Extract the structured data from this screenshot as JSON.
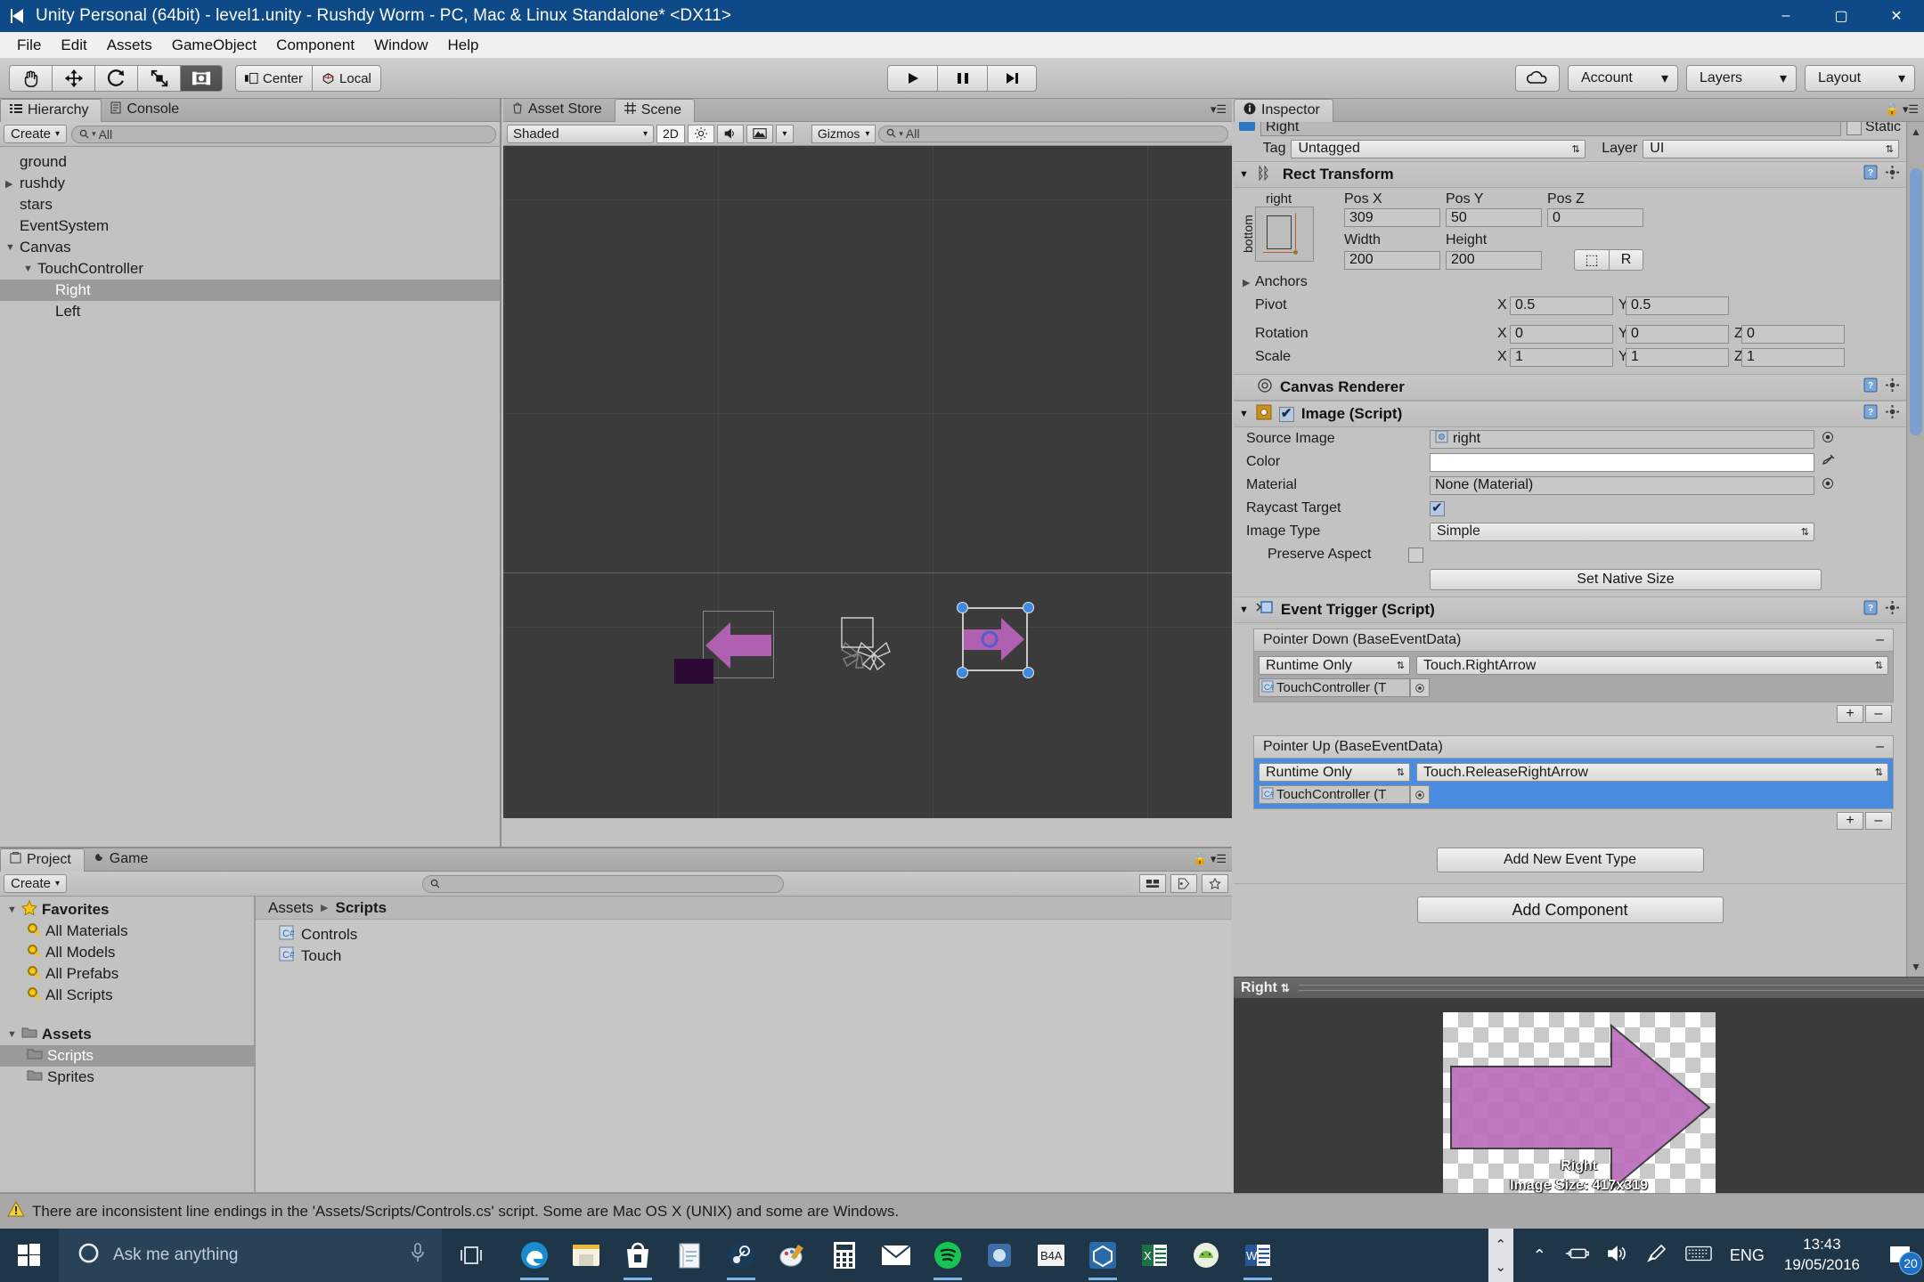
{
  "window": {
    "title": "Unity Personal (64bit) - level1.unity - Rushdy Worm - PC, Mac & Linux Standalone* <DX11>",
    "minimize": "–",
    "maximize": "▢",
    "close": "✕"
  },
  "menubar": [
    "File",
    "Edit",
    "Assets",
    "GameObject",
    "Component",
    "Window",
    "Help"
  ],
  "toolbar": {
    "transform_tools": [
      "hand-tool",
      "move-tool",
      "rotate-tool",
      "scale-tool",
      "rect-tool"
    ],
    "pivot_mode": "Center",
    "pivot_rotation": "Local",
    "play": "▶",
    "pause": "❚❚",
    "step": "▶❙",
    "cloud": "cloud-icon",
    "account": "Account",
    "layers": "Layers",
    "layout": "Layout"
  },
  "hierarchy": {
    "tabs": [
      {
        "label": "Hierarchy",
        "icon": "hierarchy-icon",
        "active": true
      },
      {
        "label": "Console",
        "icon": "console-icon",
        "active": false
      }
    ],
    "create_label": "Create",
    "search_placeholder": "All",
    "items": [
      {
        "label": "ground",
        "depth": 0,
        "arrow": "",
        "selected": false
      },
      {
        "label": "rushdy",
        "depth": 0,
        "arrow": "▶",
        "selected": false
      },
      {
        "label": "stars",
        "depth": 0,
        "arrow": "",
        "selected": false
      },
      {
        "label": "EventSystem",
        "depth": 0,
        "arrow": "",
        "selected": false
      },
      {
        "label": "Canvas",
        "depth": 0,
        "arrow": "▼",
        "selected": false
      },
      {
        "label": "TouchController",
        "depth": 1,
        "arrow": "▼",
        "selected": false
      },
      {
        "label": "Right",
        "depth": 2,
        "arrow": "",
        "selected": true
      },
      {
        "label": "Left",
        "depth": 2,
        "arrow": "",
        "selected": false
      }
    ]
  },
  "scene": {
    "tabs": [
      {
        "label": "Asset Store",
        "icon": "asset-store-icon",
        "active": false
      },
      {
        "label": "Scene",
        "icon": "scene-grid-icon",
        "active": true
      }
    ],
    "draw_mode": "Shaded",
    "toggle_2d": "2D",
    "lighting_icon": "sun-icon",
    "audio_icon": "speaker-icon",
    "effects_icon": "image-effects-icon",
    "gizmos": "Gizmos",
    "search_placeholder": "All"
  },
  "project": {
    "tabs": [
      {
        "label": "Project",
        "icon": "project-icon",
        "active": true
      },
      {
        "label": "Game",
        "icon": "game-icon",
        "active": false
      }
    ],
    "create_label": "Create",
    "search_placeholder": "",
    "favorites_label": "Favorites",
    "favorites": [
      "All Materials",
      "All Models",
      "All Prefabs",
      "All Scripts"
    ],
    "assets_label": "Assets",
    "folders": [
      {
        "label": "Scripts",
        "selected": true
      },
      {
        "label": "Sprites",
        "selected": false
      }
    ],
    "breadcrumb": [
      "Assets",
      "Scripts"
    ],
    "files": [
      {
        "label": "Controls",
        "icon": "csharp-script-icon"
      },
      {
        "label": "Touch",
        "icon": "csharp-script-icon"
      }
    ]
  },
  "inspector": {
    "tab_label": "Inspector",
    "object_name": "Right",
    "static_label": "Static",
    "tag_label": "Tag",
    "tag_value": "Untagged",
    "layer_label": "Layer",
    "layer_value": "UI",
    "rect_transform": {
      "title": "Rect Transform",
      "anchor_preset_top": "right",
      "anchor_preset_side": "bottom",
      "pos_x_label": "Pos X",
      "pos_x": "309",
      "pos_y_label": "Pos Y",
      "pos_y": "50",
      "pos_z_label": "Pos Z",
      "pos_z": "0",
      "width_label": "Width",
      "width": "200",
      "height_label": "Height",
      "height": "200",
      "blueprint_btn": "⬚",
      "raw_btn": "R",
      "anchors_label": "Anchors",
      "pivot_label": "Pivot",
      "pivot_x": "0.5",
      "pivot_y": "0.5",
      "rotation_label": "Rotation",
      "rotation_x": "0",
      "rotation_y": "0",
      "rotation_z": "0",
      "scale_label": "Scale",
      "scale_x": "1",
      "scale_y": "1",
      "scale_z": "1",
      "axis_x": "X",
      "axis_y": "Y",
      "axis_z": "Z"
    },
    "canvas_renderer": {
      "title": "Canvas Renderer"
    },
    "image_script": {
      "title": "Image (Script)",
      "enabled": true,
      "source_image_label": "Source Image",
      "source_image_value": "right",
      "color_label": "Color",
      "color_value": "#FFFFFF",
      "material_label": "Material",
      "material_value": "None (Material)",
      "raycast_label": "Raycast Target",
      "raycast_checked": true,
      "image_type_label": "Image Type",
      "image_type_value": "Simple",
      "preserve_aspect_label": "Preserve Aspect",
      "preserve_aspect_checked": false,
      "set_native_size": "Set Native Size"
    },
    "event_trigger": {
      "title": "Event Trigger (Script)",
      "events": [
        {
          "name": "Pointer Down (BaseEventData)",
          "remove": "–",
          "selected": false,
          "mode": "Runtime Only",
          "function": "Touch.RightArrow",
          "object": "TouchController (T",
          "add_btn": "+",
          "remove_btn": "–"
        },
        {
          "name": "Pointer Up (BaseEventData)",
          "remove": "–",
          "selected": true,
          "mode": "Runtime Only",
          "function": "Touch.ReleaseRightArrow",
          "object": "TouchController (T",
          "add_btn": "+",
          "remove_btn": "–"
        }
      ],
      "add_new_event_type": "Add New Event Type"
    },
    "add_component": "Add Component",
    "preview": {
      "title": "Right",
      "caption_name": "Right",
      "caption_size": "Image Size: 417x319"
    }
  },
  "statusbar": {
    "icon": "warning-icon",
    "message": "There are inconsistent line endings in the 'Assets/Scripts/Controls.cs' script. Some are Mac OS X (UNIX) and some are Windows."
  },
  "taskbar": {
    "start_icon": "windows-start-icon",
    "search_placeholder": "Ask me anything",
    "cortana_icon": "cortana-circle-icon",
    "mic_icon": "microphone-icon",
    "taskview_icon": "task-view-icon",
    "apps": [
      {
        "name": "edge-icon",
        "running": true
      },
      {
        "name": "file-explorer-icon",
        "running": false
      },
      {
        "name": "store-icon",
        "running": true
      },
      {
        "name": "notepad-icon",
        "running": false
      },
      {
        "name": "steam-icon",
        "running": true
      },
      {
        "name": "paint-icon",
        "running": false
      },
      {
        "name": "calculator-icon",
        "running": false
      },
      {
        "name": "mail-icon",
        "running": false
      },
      {
        "name": "spotify-icon",
        "running": true
      },
      {
        "name": "app-icon",
        "running": false
      },
      {
        "name": "b4a-icon",
        "running": false
      },
      {
        "name": "unity-icon",
        "running": true
      },
      {
        "name": "excel-icon",
        "running": false
      },
      {
        "name": "android-icon",
        "running": false
      },
      {
        "name": "word-icon",
        "running": true
      }
    ],
    "tray": {
      "chevron": "⌃",
      "battery_icon": "battery-icon",
      "volume_icon": "volume-icon",
      "pen_icon": "pen-icon",
      "keyboard_icon": "keyboard-icon",
      "language": "ENG",
      "time": "13:43",
      "date": "19/05/2016",
      "notifications_icon": "action-center-icon",
      "notification_count": "20"
    }
  },
  "colors": {
    "title_blue": "#0d4a87",
    "unity_gray": "#c2c2c2",
    "selection_blue": "#4a8de0",
    "arrow_purple": "#b060b0",
    "taskbar": "#1f3548"
  }
}
